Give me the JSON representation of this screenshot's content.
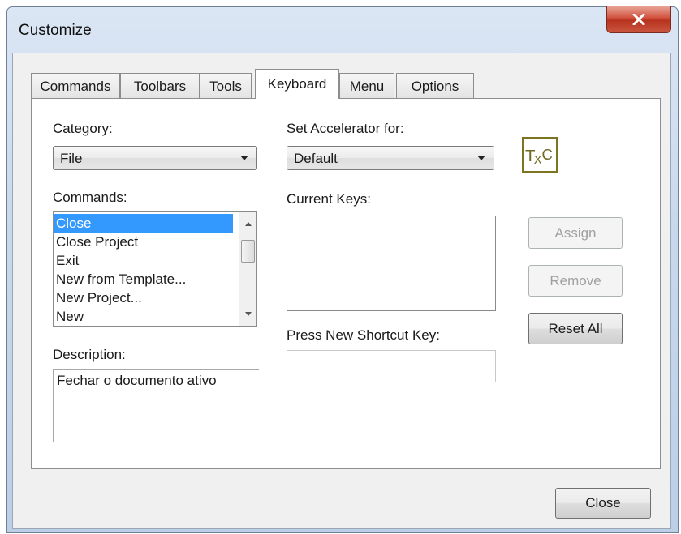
{
  "window": {
    "title": "Customize"
  },
  "tabs": [
    {
      "label": "Commands",
      "active": false
    },
    {
      "label": "Toolbars",
      "active": false
    },
    {
      "label": "Tools",
      "active": false
    },
    {
      "label": "Keyboard",
      "active": true
    },
    {
      "label": "Menu",
      "active": false
    },
    {
      "label": "Options",
      "active": false
    }
  ],
  "keyboard": {
    "category_label": "Category:",
    "category_value": "File",
    "commands_label": "Commands:",
    "commands": [
      {
        "label": "Close",
        "selected": true
      },
      {
        "label": "Close Project",
        "selected": false
      },
      {
        "label": "Exit",
        "selected": false
      },
      {
        "label": "New from Template...",
        "selected": false
      },
      {
        "label": "New Project...",
        "selected": false
      },
      {
        "label": "New",
        "selected": false
      }
    ],
    "description_label": "Description:",
    "description_value": "Fechar o documento ativo",
    "accelerator_label": "Set Accelerator for:",
    "accelerator_value": "Default",
    "current_keys_label": "Current Keys:",
    "shortcut_label": "Press New Shortcut Key:",
    "shortcut_value": "",
    "logo_text": "TXC",
    "buttons": {
      "assign": "Assign",
      "remove": "Remove",
      "reset_all": "Reset All"
    }
  },
  "footer": {
    "close_label": "Close"
  },
  "colors": {
    "selection": "#3399ff",
    "logo_border": "#7d7420",
    "close_button": "#c9412b"
  },
  "icons": {
    "window_close": "close-icon",
    "dropdown": "chevron-down-icon"
  }
}
